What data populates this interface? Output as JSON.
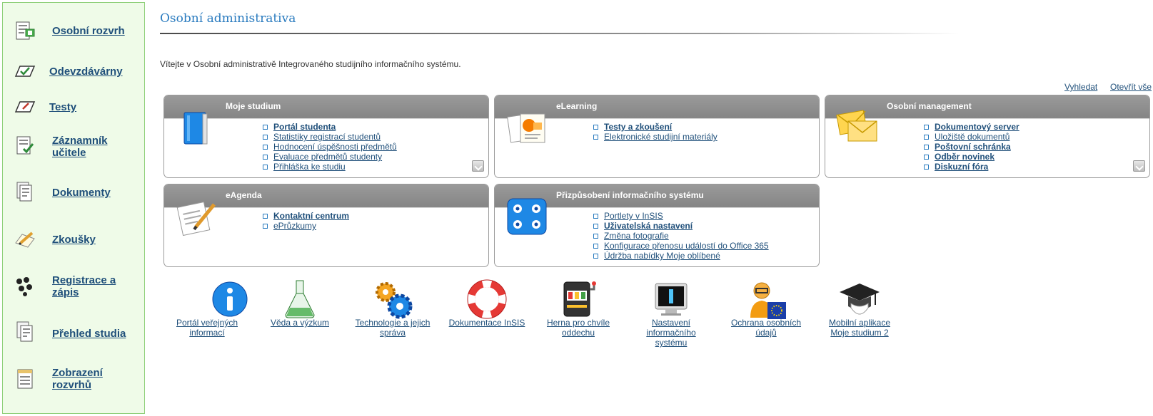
{
  "sidebar": {
    "items": [
      {
        "label": "Osobní rozvrh"
      },
      {
        "label": "Odevzdávárny"
      },
      {
        "label": "Testy"
      },
      {
        "label": "Záznamník učitele"
      },
      {
        "label": "Dokumenty"
      },
      {
        "label": "Zkoušky"
      },
      {
        "label": "Registrace a zápis"
      },
      {
        "label": "Přehled studia"
      },
      {
        "label": "Zobrazení rozvrhů"
      }
    ]
  },
  "header": {
    "title": "Osobní administrativa",
    "welcome": "Vítejte v Osobní administrativě Integrovaného studijního informačního systému.",
    "search_link": "Vyhledat",
    "open_all_link": "Otevřít vše"
  },
  "panels": [
    {
      "title": "Moje studium",
      "icon": "book-icon",
      "links": [
        "Portál studenta",
        "Statistiky registrací studentů",
        "Hodnocení úspěšnosti předmětů",
        "Evaluace předmětů studenty",
        "Přihláška ke studiu"
      ]
    },
    {
      "title": "eLearning",
      "icon": "presentation-icon",
      "links": [
        "Testy a zkoušení",
        "Elektronické studijní materiály"
      ]
    },
    {
      "title": "Osobní management",
      "icon": "envelopes-icon",
      "links": [
        "Dokumentový server",
        "Uložiště dokumentů",
        "Poštovní schránka",
        "Odběr novinek",
        "Diskuzní fóra"
      ]
    },
    {
      "title": "eAgenda",
      "icon": "notepad-icon",
      "links": [
        "Kontaktní centrum",
        "ePrůzkumy"
      ]
    },
    {
      "title": "Přizpůsobení informačního systému",
      "icon": "settings-dots-icon",
      "links": [
        "Portlety v InSIS",
        "Uživatelská nastavení",
        "Změna fotografie",
        "Konfigurace přenosu událostí do Office 365",
        "Údržba nabídky Moje oblíbené"
      ]
    }
  ],
  "tiles": [
    {
      "label": "Portál veřejných informací",
      "icon": "info-icon"
    },
    {
      "label": "Věda a výzkum",
      "icon": "flask-icon"
    },
    {
      "label": "Technologie a jejich správa",
      "icon": "gears-icon"
    },
    {
      "label": "Dokumentace InSIS",
      "icon": "lifebuoy-icon"
    },
    {
      "label": "Herna pro chvíle oddechu",
      "icon": "slot-machine-icon"
    },
    {
      "label": "Nastavení informačního systému",
      "icon": "monitor-icon"
    },
    {
      "label": "Ochrana osobních údajů",
      "icon": "person-eu-icon"
    },
    {
      "label": "Mobilní aplikace Moje studium 2",
      "icon": "graduation-cap-icon"
    }
  ],
  "colors": {
    "sidebar_bg": "#effbe8",
    "sidebar_border": "#8fd07a",
    "title": "#2a7bbf",
    "link": "#1f4f7a",
    "panel_header": "#8c8c8c"
  }
}
